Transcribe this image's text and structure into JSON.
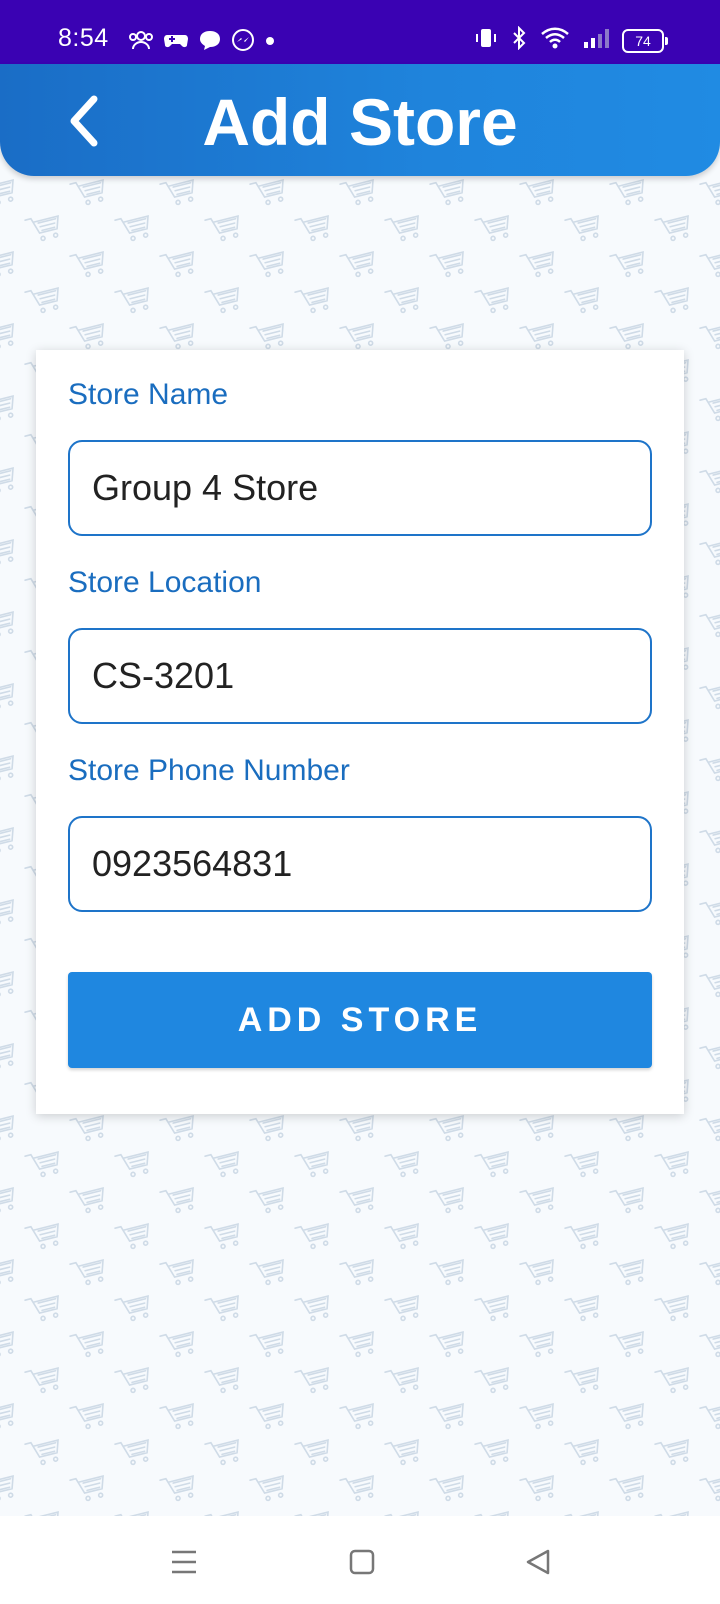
{
  "status_bar": {
    "time": "8:54",
    "notification_icons": [
      "group-icon",
      "game-controller-icon",
      "chat-bubble-icon",
      "messenger-icon",
      "dot-icon"
    ],
    "system_icons": [
      "vibrate-icon",
      "bluetooth-icon",
      "wifi-icon",
      "cell-signal-icon"
    ],
    "battery": "74",
    "background_color": "#3a02b3"
  },
  "app_bar": {
    "title": "Add Store",
    "back_icon": "chevron-left-icon",
    "gradient": [
      "#1a6dc6",
      "#208be3"
    ]
  },
  "form": {
    "store_name": {
      "label": "Store Name",
      "value": "Group 4 Store"
    },
    "store_location": {
      "label": "Store Location",
      "value": "CS-3201"
    },
    "store_phone": {
      "label": "Store Phone Number",
      "value": "0923564831"
    },
    "submit_label": "ADD STORE",
    "accent_color": "#1f87e0",
    "label_color": "#1a6dbf"
  },
  "background": {
    "pattern_icon": "shopping-cart-icon"
  },
  "nav_bar": {
    "buttons": [
      "menu-icon",
      "home-square-icon",
      "back-triangle-icon"
    ]
  }
}
